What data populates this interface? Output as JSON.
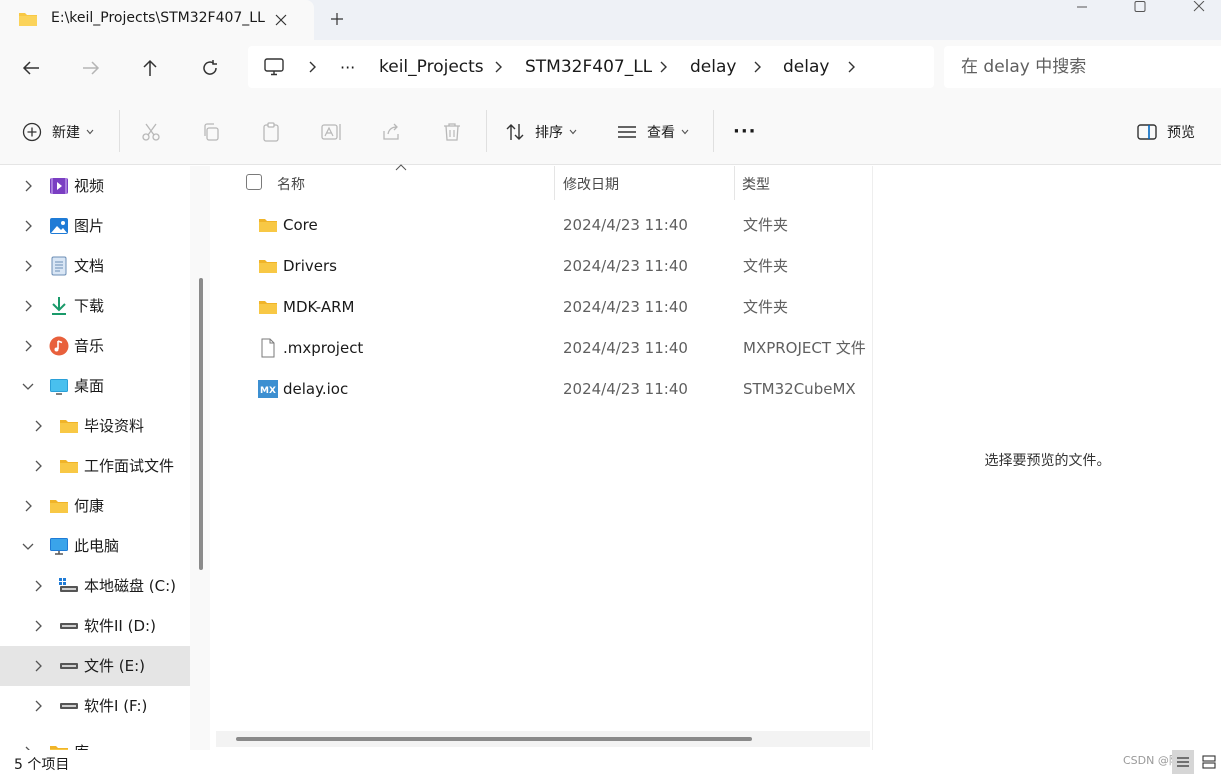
{
  "window": {
    "tab_title": "E:\\keil_Projects\\STM32F407_LL"
  },
  "breadcrumb": {
    "overflow": "···",
    "items": [
      "keil_Projects",
      "STM32F407_LL",
      "delay",
      "delay"
    ]
  },
  "search": {
    "placeholder": "在 delay 中搜索"
  },
  "toolbar": {
    "new_label": "新建",
    "sort_label": "排序",
    "view_label": "查看",
    "more_label": "···",
    "preview_label": "预览"
  },
  "sidebar": {
    "items": [
      {
        "label": "视频",
        "icon": "video-icon"
      },
      {
        "label": "图片",
        "icon": "pictures-icon"
      },
      {
        "label": "文档",
        "icon": "documents-icon"
      },
      {
        "label": "下载",
        "icon": "download-icon"
      },
      {
        "label": "音乐",
        "icon": "music-icon"
      },
      {
        "label": "桌面",
        "icon": "desktop-icon",
        "expanded": true
      },
      {
        "label": "毕设资料",
        "icon": "folder-icon"
      },
      {
        "label": "工作面试文件",
        "icon": "folder-icon"
      },
      {
        "label": "何康",
        "icon": "folder-icon"
      },
      {
        "label": "此电脑",
        "icon": "this-pc-icon",
        "expanded": true
      },
      {
        "label": "本地磁盘 (C:)",
        "icon": "drive-icon"
      },
      {
        "label": "软件II (D:)",
        "icon": "drive-icon"
      },
      {
        "label": "文件 (E:)",
        "icon": "drive-icon",
        "selected": true
      },
      {
        "label": "软件I (F:)",
        "icon": "drive-icon"
      },
      {
        "label": "库",
        "icon": "folder-icon"
      }
    ]
  },
  "file_list": {
    "columns": {
      "name": "名称",
      "modified": "修改日期",
      "type": "类型"
    },
    "rows": [
      {
        "name": "Core",
        "modified": "2024/4/23 11:40",
        "type": "文件夹",
        "icon": "folder-icon"
      },
      {
        "name": "Drivers",
        "modified": "2024/4/23 11:40",
        "type": "文件夹",
        "icon": "folder-icon"
      },
      {
        "name": "MDK-ARM",
        "modified": "2024/4/23 11:40",
        "type": "文件夹",
        "icon": "folder-icon"
      },
      {
        "name": ".mxproject",
        "modified": "2024/4/23 11:40",
        "type": "MXPROJECT 文件",
        "icon": "file-icon"
      },
      {
        "name": "delay.ioc",
        "modified": "2024/4/23 11:40",
        "type": "STM32CubeMX",
        "icon": "stm32cubemx-icon"
      }
    ]
  },
  "preview": {
    "message": "选择要预览的文件。"
  },
  "status": {
    "item_count": "5 个项目",
    "watermark": "CSDN @阿康"
  },
  "colors": {
    "accent": "#0067c0",
    "folder": "#f8c845",
    "selected_bg": "#e5e5e5",
    "titlebar_bg": "#eef1f6"
  }
}
